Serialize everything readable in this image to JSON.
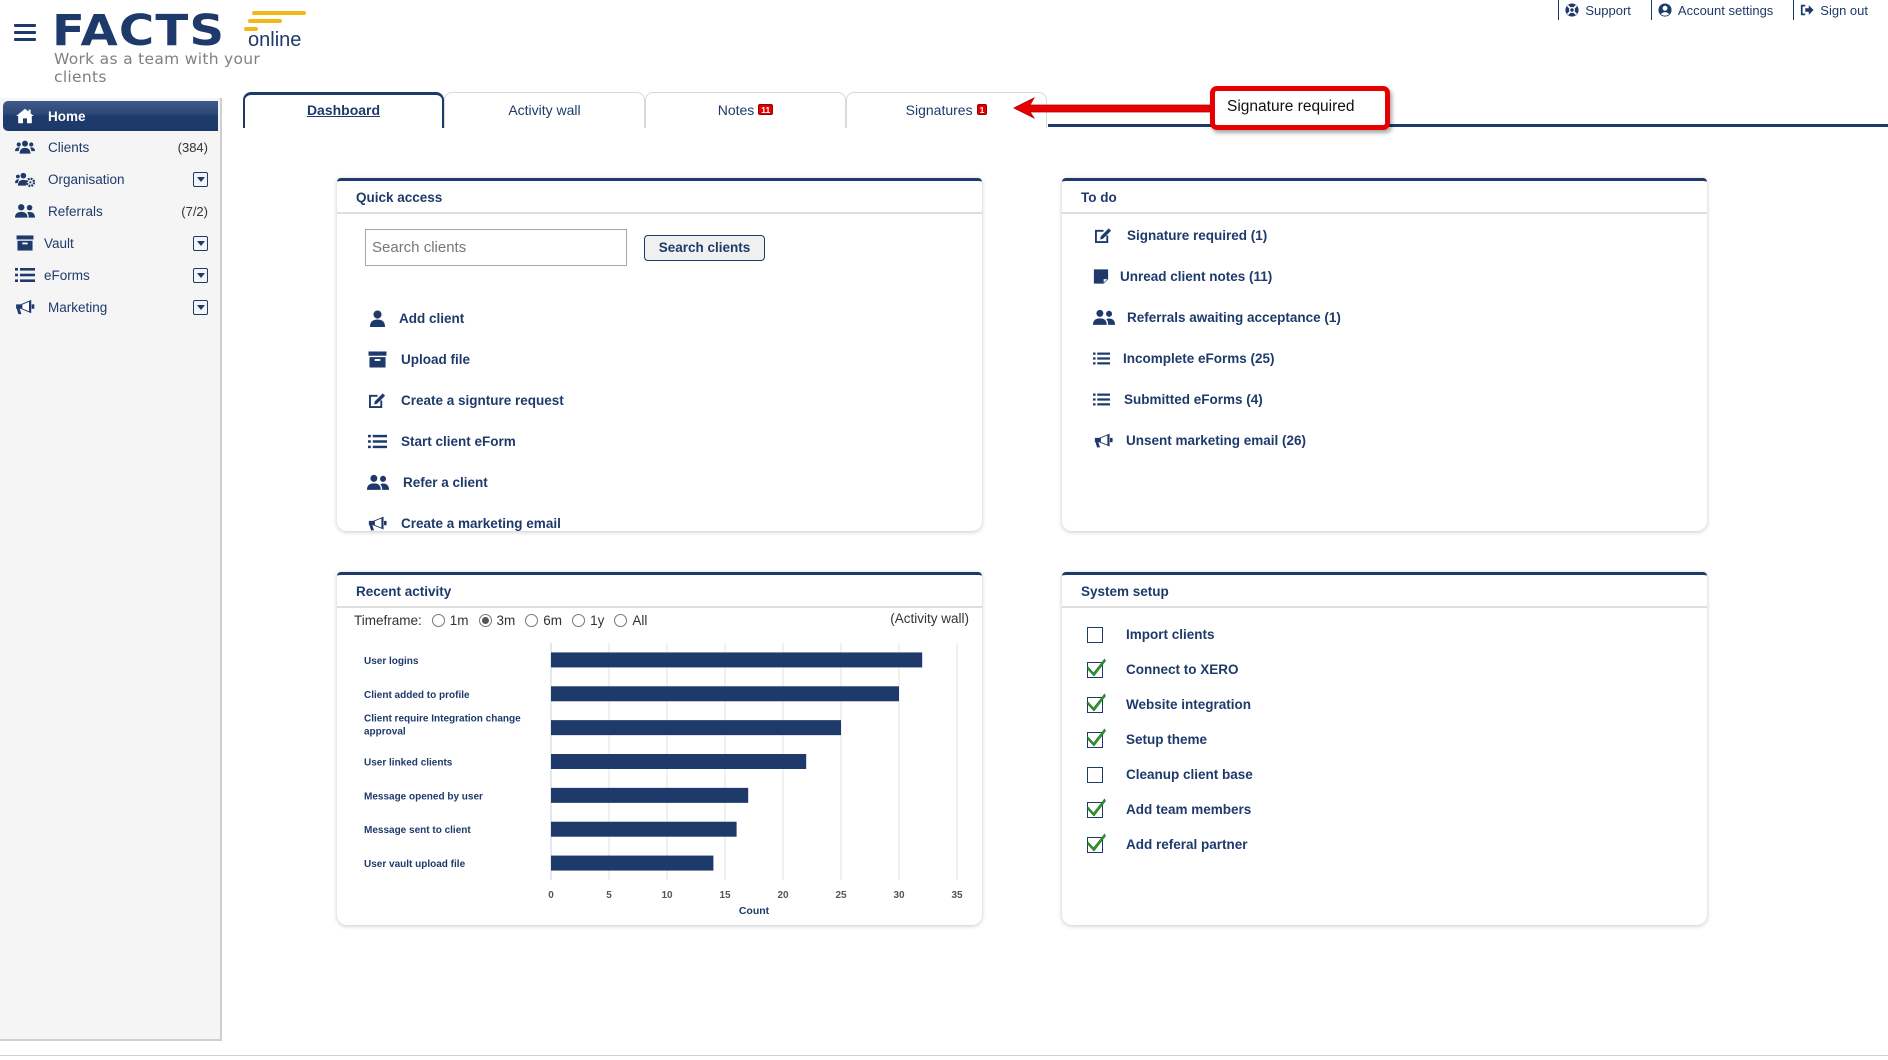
{
  "header": {
    "logo_main": "FACTS",
    "logo_suffix": "online",
    "tagline": "Work as a team with your clients",
    "links": [
      {
        "label": "Support",
        "icon": "lifebuoy-icon"
      },
      {
        "label": "Account settings",
        "icon": "user-circle-icon"
      },
      {
        "label": "Sign out",
        "icon": "sign-out-icon"
      }
    ]
  },
  "sidebar": {
    "items": [
      {
        "label": "Home",
        "icon": "home-icon",
        "active": true
      },
      {
        "label": "Clients",
        "icon": "users-icon",
        "count": "(384)"
      },
      {
        "label": "Organisation",
        "icon": "users-cog-icon",
        "dropdown": true
      },
      {
        "label": "Referrals",
        "icon": "user-friends-icon",
        "count": "(7/2)"
      },
      {
        "label": "Vault",
        "icon": "archive-icon",
        "dropdown": true
      },
      {
        "label": "eForms",
        "icon": "list-icon",
        "dropdown": true
      },
      {
        "label": "Marketing",
        "icon": "megaphone-icon",
        "dropdown": true
      }
    ]
  },
  "tabs": [
    {
      "label": "Dashboard",
      "active": true
    },
    {
      "label": "Activity wall"
    },
    {
      "label": "Notes",
      "badge": "11"
    },
    {
      "label": "Signatures",
      "badge": "1"
    }
  ],
  "callout": {
    "text": "Signature required",
    "color": "#e60000"
  },
  "quick_access": {
    "title": "Quick access",
    "search_placeholder": "Search clients",
    "search_value": "",
    "search_button": "Search clients",
    "links": [
      {
        "label": "Add client",
        "icon": "user-icon"
      },
      {
        "label": "Upload file",
        "icon": "archive-icon"
      },
      {
        "label": "Create a signture request",
        "icon": "edit-icon"
      },
      {
        "label": "Start client eForm",
        "icon": "list-icon"
      },
      {
        "label": "Refer a client",
        "icon": "user-friends-icon"
      },
      {
        "label": "Create a marketing email",
        "icon": "megaphone-icon"
      }
    ]
  },
  "todo": {
    "title": "To do",
    "items": [
      {
        "label": "Signature required (1)",
        "icon": "edit-icon"
      },
      {
        "label": "Unread client notes (11)",
        "icon": "sticky-note-icon"
      },
      {
        "label": "Referrals awaiting acceptance (1)",
        "icon": "user-friends-icon"
      },
      {
        "label": "Incomplete eForms (25)",
        "icon": "list-icon"
      },
      {
        "label": "Submitted eForms (4)",
        "icon": "list-icon"
      },
      {
        "label": "Unsent marketing email (26)",
        "icon": "megaphone-icon"
      }
    ]
  },
  "recent_activity": {
    "title": "Recent activity",
    "timeframe_label": "Timeframe:",
    "timeframe_options": [
      "1m",
      "3m",
      "6m",
      "1y",
      "All"
    ],
    "timeframe_selected": "3m",
    "activity_wall_link": "(Activity wall)"
  },
  "chart_data": {
    "type": "bar",
    "orientation": "horizontal",
    "categories": [
      "User logins",
      "Client added to profile",
      "Client require Integration change approval",
      "User linked clients",
      "Message opened by user",
      "Message sent to client",
      "User vault upload file"
    ],
    "values": [
      32,
      30,
      25,
      22,
      17,
      16,
      14
    ],
    "title": "",
    "xlabel": "Count",
    "ylabel": "",
    "xlim": [
      0,
      35
    ],
    "xticks": [
      0,
      5,
      10,
      15,
      20,
      25,
      30,
      35
    ],
    "grid": true,
    "bar_color": "#1e3a6b",
    "legend": "none"
  },
  "system_setup": {
    "title": "System setup",
    "items": [
      {
        "label": "Import clients",
        "checked": false
      },
      {
        "label": "Connect to XERO",
        "checked": true
      },
      {
        "label": "Website integration",
        "checked": true
      },
      {
        "label": "Setup theme",
        "checked": true
      },
      {
        "label": "Cleanup client base",
        "checked": false
      },
      {
        "label": "Add team members",
        "checked": true
      },
      {
        "label": "Add referal partner",
        "checked": true
      }
    ]
  },
  "colors": {
    "brand": "#1e3a6b",
    "accent": "#f3b716",
    "badge": "#e00000",
    "check": "#2e9a2e"
  }
}
